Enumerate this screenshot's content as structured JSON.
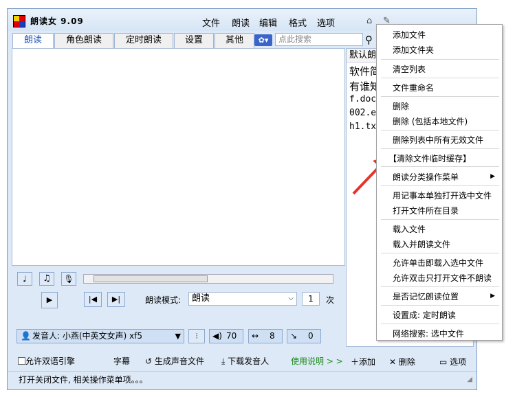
{
  "app": {
    "title": "朗读女 9.09"
  },
  "menubar": [
    "文件",
    "朗读",
    "编辑",
    "格式",
    "选项"
  ],
  "tabs": [
    "朗读",
    "角色朗读",
    "定时朗读",
    "设置",
    "其他"
  ],
  "search": {
    "placeholder": "点此搜索"
  },
  "file_list": {
    "header": "默认朗",
    "rows": [
      "软件简",
      "有谁知",
      "f.doc",
      "002.e",
      "h1.tx"
    ]
  },
  "controls": {
    "mode_label": "朗读模式:",
    "mode_value": "朗读",
    "repeat_value": "1",
    "repeat_unit": "次",
    "speaker": "发音人: 小燕(中英文女声) xf5",
    "volume": "70",
    "speed": "8",
    "pitch": "0"
  },
  "bottom": {
    "bilingual": "允许双语引擎",
    "subtitle": "字幕",
    "generate": "生成声音文件",
    "download": "下载发音人",
    "help": "使用说明 > >",
    "add": "添加",
    "delete": "删除",
    "options": "选项"
  },
  "status": "打开关闭文件, 相关操作菜单项。。。",
  "context_menu": [
    "添加文件",
    "添加文件夹",
    "清空列表",
    "文件重命名",
    "删除",
    "删除 (包括本地文件)",
    "删除列表中所有无效文件",
    "【清除文件临时缓存】",
    "朗读分类操作菜单",
    "用记事本单独打开选中文件",
    "打开文件所在目录",
    "载入文件",
    "载入并朗读文件",
    "允许单击即载入选中文件",
    "允许双击只打开文件不朗读",
    "是否记忆朗读位置",
    "设置成: 定时朗读",
    "网络搜索: 选中文件"
  ],
  "colors": {
    "accent": "#1e54b8",
    "window_bg": "#dde9f6",
    "arrow": "#e8332a",
    "help_link": "#1a8a1a"
  }
}
